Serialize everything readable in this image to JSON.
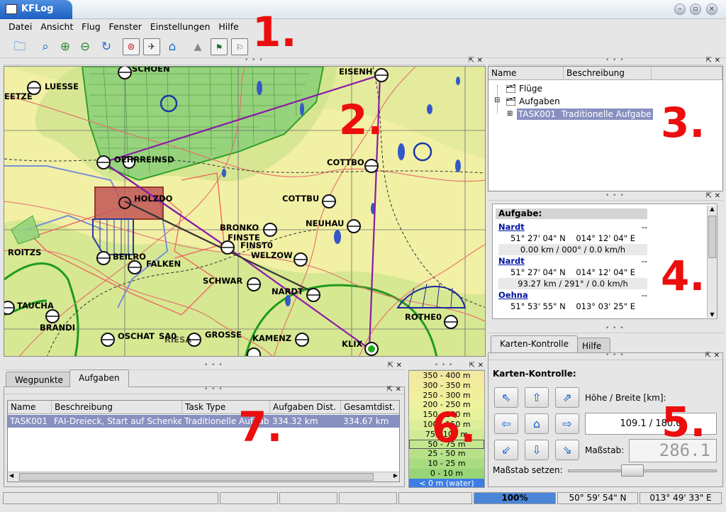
{
  "window": {
    "title": "KFLog"
  },
  "menu": {
    "items": [
      "Datei",
      "Ansicht",
      "Flug",
      "Fenster",
      "Einstellungen",
      "Hilfe"
    ]
  },
  "toolbar": {
    "icons": [
      "open-folder-icon",
      "zoom-icon",
      "zoom-in-icon",
      "zoom-out-icon",
      "refresh-icon",
      "map-center-icon",
      "flight-icon",
      "home-icon",
      "terrain-icon",
      "task-icon",
      "optimize-icon"
    ]
  },
  "annotations": {
    "n1": "1.",
    "n2": "2.",
    "n3": "3.",
    "n4": "4.",
    "n5": "5.",
    "n6": "6.",
    "n7": "7."
  },
  "map": {
    "labels": [
      "SCHOEN",
      "EISENH",
      "LUESSE",
      "EETZE",
      "OEHRREINSD",
      "COTTBO",
      "HOLZDO",
      "COTTBU",
      "NEUHAU",
      "BRONKO",
      "FINSTE",
      "FINST0",
      "WELZOW",
      "ROITZS",
      "BEILRO",
      "FALKEN",
      "SCHWAR",
      "NARDT",
      "TAUCHA",
      "ROTHE0",
      "BRANDI",
      "OSCHAT",
      "SA0",
      "RIESA",
      "GROSSE",
      "KAMENZ",
      "KLIX"
    ]
  },
  "tree": {
    "columns": [
      "Name",
      "Beschreibung"
    ],
    "nodes": [
      {
        "label": "Flüge"
      },
      {
        "label": "Aufgaben"
      },
      {
        "label": "TASK001",
        "desc": "Traditionelle Aufgabe"
      }
    ]
  },
  "task_info": {
    "header": "Aufgabe:",
    "points": [
      {
        "name": "Nardt",
        "flag": "--",
        "lat": "51° 27' 04\" N",
        "lon": "014° 12' 04\" E",
        "leg": "0.00 km / 000° / 0.0 km/h"
      },
      {
        "name": "Nardt",
        "flag": "--",
        "lat": "51° 27' 04\" N",
        "lon": "014° 12' 04\" E",
        "leg": "93.27 km / 291° / 0.0 km/h"
      },
      {
        "name": "Oehna",
        "flag": "--",
        "lat": "51° 53' 55\" N",
        "lon": "013° 03' 25\" E",
        "leg": ""
      }
    ]
  },
  "bottom_tabs": [
    "Wegpunkte",
    "Aufgaben"
  ],
  "task_table": {
    "columns": [
      "Name",
      "Beschreibung",
      "Task Type",
      "Aufgaben Dist.",
      "Gesamtdist."
    ],
    "rows": [
      [
        "TASK001",
        "FAI-Dreieck, Start auf Schenkel",
        "Traditionelle Aufgabe",
        "334.32 km",
        "334.67 km"
      ]
    ]
  },
  "legend": {
    "rows": [
      {
        "label": "350 - 400 m",
        "color": "#f5e9a0"
      },
      {
        "label": "300 - 350 m",
        "color": "#f3ec9e"
      },
      {
        "label": "250 - 300 m",
        "color": "#f1ef9c"
      },
      {
        "label": "200 - 250 m",
        "color": "#eef29c"
      },
      {
        "label": "150 - 200 m",
        "color": "#e7f29c"
      },
      {
        "label": "100 - 150 m",
        "color": "#dcee9a"
      },
      {
        "label": "75 - 100 m",
        "color": "#d0ea96"
      },
      {
        "label": "50 - 75 m",
        "color": "#c4e690"
      },
      {
        "label": "25 - 50 m",
        "color": "#b8e28a"
      },
      {
        "label": "10 - 25 m",
        "color": "#a8dc80"
      },
      {
        "label": "0 - 10 m",
        "color": "#98d476"
      },
      {
        "label": "< 0 m (water)",
        "color": "#3c7ee6"
      }
    ]
  },
  "control": {
    "tabs": [
      "Karten-Kontrolle",
      "Hilfe"
    ],
    "title": "Karten-Kontrolle:",
    "size_label": "Höhe / Breite [km]:",
    "size_value": "109.1 / 180.0",
    "scale_label": "Maßstab:",
    "scale_value": "286.1",
    "set_scale_label": "Maßstab setzen:",
    "slider_value": 0.42
  },
  "status": {
    "progress": "100%",
    "lat": "50° 59' 54\" N",
    "lon": "013° 49' 33\" E"
  },
  "colors": {
    "accent": "#1d5fc2",
    "selection": "#8890c0",
    "annotation": "#ec0d0d"
  }
}
